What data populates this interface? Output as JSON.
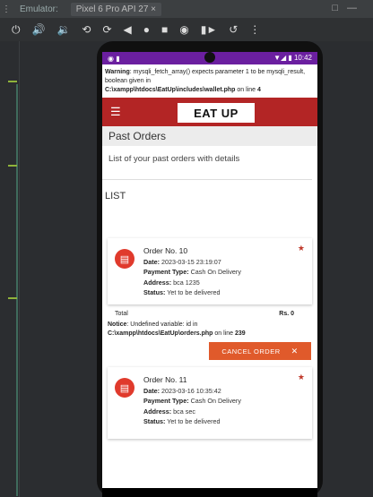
{
  "ide": {
    "tab_emulator": "Emulator:",
    "tab_device": "Pixel 6 Pro API 27  ×",
    "toolbar_icons": [
      "power-icon",
      "volume-up-icon",
      "volume-down-icon",
      "rotate-left-icon",
      "rotate-right-icon",
      "back-icon",
      "home-icon",
      "overview-icon",
      "camera-icon",
      "screenrecord-icon",
      "replay-icon",
      "more-icon"
    ]
  },
  "status": {
    "time": "10:42",
    "right_icons": "▼◢ ▮ 10:42"
  },
  "warning": {
    "label": "Warning",
    "text": ": mysqli_fetch_array() expects parameter 1 to be mysqli_result, boolean given in",
    "path": "C:\\xampp\\htdocs\\EatUp\\includes\\wallet.php",
    "on_line": " on line ",
    "line": "4"
  },
  "appbar": {
    "logo": "EAT UP"
  },
  "page": {
    "title": "Past Orders",
    "subtitle": "List of your past orders with details",
    "list_label": "LIST"
  },
  "orders": [
    {
      "title": "Order No. 10",
      "date_label": "Date:",
      "date": " 2023-03-15 23:19:07",
      "payment_label": "Payment Type:",
      "payment": " Cash On Delivery",
      "address_label": "Address:",
      "address": " bca 1235",
      "status_label": "Status:",
      "status": " Yet to be delivered"
    },
    {
      "title": "Order No. 11",
      "date_label": "Date:",
      "date": " 2023-03-16 10:35:42",
      "payment_label": "Payment Type:",
      "payment": " Cash On Delivery",
      "address_label": "Address:",
      "address": " bca sec",
      "status_label": "Status:",
      "status": " Yet to be delivered"
    }
  ],
  "total": {
    "label": "Total",
    "value": "Rs. 0"
  },
  "notice": {
    "label": "Notice",
    "text": ": Undefined variable: id in",
    "path": "C:\\xampp\\htdocs\\EatUp\\orders.php",
    "on_line": " on line ",
    "line": "239"
  },
  "cancel": {
    "label": "CANCEL ORDER",
    "x": "✕"
  },
  "colors": {
    "appbar": "#b32525",
    "statusbar": "#6b1fa0",
    "cancel": "#e05a2b",
    "order_icon": "#e03a2c"
  }
}
